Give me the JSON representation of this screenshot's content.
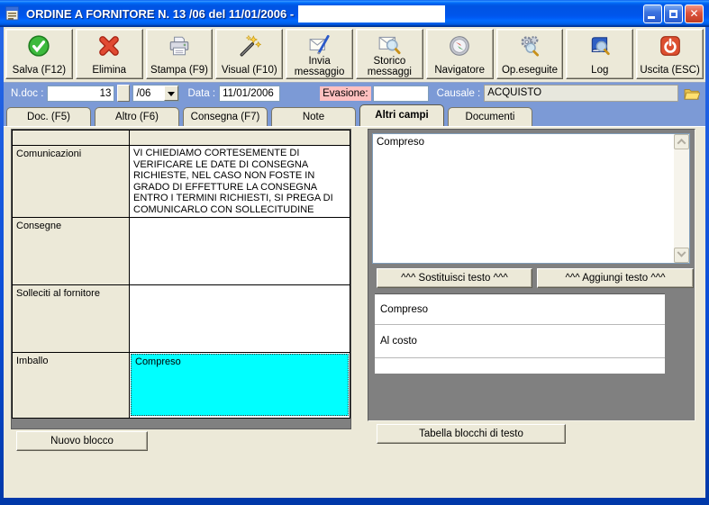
{
  "window": {
    "title": "ORDINE A FORNITORE N. 13 /06 del 11/01/2006 -",
    "controls": {
      "minimize": "minimize",
      "maximize": "maximize",
      "close": "close"
    }
  },
  "colors": {
    "titlebar_blue": "#0054E3",
    "panel_beige": "#ECE9D8",
    "fieldrow_blue": "#7C9AD6",
    "selected_cell_cyan": "#00FFFF",
    "evasione_pink": "#FFC0C0",
    "grid_filler_gray": "#808080"
  },
  "toolbar": {
    "buttons": [
      {
        "label": "Salva (F12)",
        "icon": "save-check-icon"
      },
      {
        "label": "Elimina",
        "icon": "delete-x-icon"
      },
      {
        "label": "Stampa (F9)",
        "icon": "printer-icon"
      },
      {
        "label": "Visual (F10)",
        "icon": "magic-wand-icon"
      },
      {
        "label": "Invia messaggio",
        "icon": "send-message-icon"
      },
      {
        "label": "Storico messaggi",
        "icon": "message-history-icon"
      },
      {
        "label": "Navigatore",
        "icon": "compass-icon"
      },
      {
        "label": "Op.eseguite",
        "icon": "gears-icon"
      },
      {
        "label": "Log",
        "icon": "log-book-icon"
      },
      {
        "label": "Uscita (ESC)",
        "icon": "power-icon"
      }
    ]
  },
  "fields": {
    "ndoc_label": "N.doc :",
    "ndoc_value": "13",
    "suffix_value": "/06",
    "data_label": "Data :",
    "data_value": "11/01/2006",
    "evasione_label": "Evasione:",
    "evasione_value": "",
    "causale_label": "Causale :",
    "causale_value": "ACQUISTO"
  },
  "tabs": [
    {
      "label": "Doc. (F5)",
      "active": false
    },
    {
      "label": "Altro (F6)",
      "active": false
    },
    {
      "label": "Consegna (F7)",
      "active": false
    },
    {
      "label": "Note",
      "active": false
    },
    {
      "label": "Altri campi",
      "active": true
    },
    {
      "label": "Documenti",
      "active": false
    }
  ],
  "grid": {
    "rows": [
      {
        "label": "Comunicazioni",
        "value": "VI CHIEDIAMO CORTESEMENTE DI VERIFICARE LE DATE DI CONSEGNA RICHIESTE, NEL CASO NON FOSTE IN GRADO DI EFFETTURE LA CONSEGNA ENTRO I TERMINI RICHIESTI, SI PREGA DI COMUNICARLO CON SOLLECITUDINE",
        "selected": false
      },
      {
        "label": "Consegne",
        "value": "",
        "selected": false
      },
      {
        "label": "Solleciti al fornitore",
        "value": "",
        "selected": false
      },
      {
        "label": "Imballo",
        "value": "Compreso",
        "selected": true
      }
    ]
  },
  "left_actions": {
    "nuovo_blocco_label": "Nuovo blocco"
  },
  "right_panel": {
    "textarea_value": "Compreso",
    "sostituisci_label": "^^^ Sostituisci testo ^^^",
    "aggiungi_label": "^^^ Aggiungi testo ^^^",
    "blocks": [
      "Compreso",
      "Al costo"
    ],
    "tabella_label": "Tabella blocchi di testo"
  }
}
